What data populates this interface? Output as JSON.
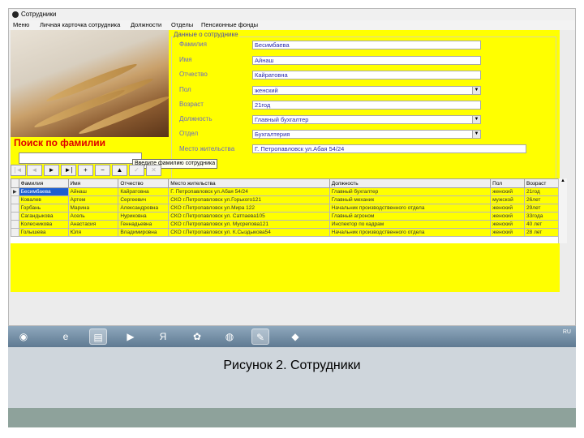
{
  "window": {
    "title": "Сотрудники"
  },
  "menu": [
    "Меню",
    "Личная карточка сотрудника",
    "Должности",
    "Отделы",
    "Пенсионные фонды"
  ],
  "details": {
    "group_title": "Данные о сотруднике",
    "fields": [
      {
        "label": "Фамилия",
        "value": "Бесимбаева",
        "type": "text"
      },
      {
        "label": "Имя",
        "value": "Айнаш",
        "type": "text"
      },
      {
        "label": "Отчество",
        "value": "Кайратовна",
        "type": "text"
      },
      {
        "label": "Пол",
        "value": "женский",
        "type": "combo"
      },
      {
        "label": "Возраст",
        "value": "21год",
        "type": "text"
      },
      {
        "label": "Должность",
        "value": "Главный бухгалтер",
        "type": "combo"
      },
      {
        "label": "Отдел",
        "value": "Бухгалтерия",
        "type": "combo"
      },
      {
        "label": "Место жительства",
        "value": "Г. Петропавловск ул.Абая 54/24",
        "type": "text"
      }
    ]
  },
  "search": {
    "title": "Поиск по фамилии",
    "input_value": "",
    "tooltip": "Введите фамилию сотрудника"
  },
  "navigator": {
    "buttons": [
      {
        "icon": "first-record-icon",
        "glyph": "|◄",
        "enabled": false
      },
      {
        "icon": "prior-record-icon",
        "glyph": "◄",
        "enabled": false
      },
      {
        "icon": "next-record-icon",
        "glyph": "►",
        "enabled": true
      },
      {
        "icon": "last-record-icon",
        "glyph": "►|",
        "enabled": true
      },
      {
        "icon": "insert-record-icon",
        "glyph": "+",
        "enabled": true
      },
      {
        "icon": "delete-record-icon",
        "glyph": "−",
        "enabled": true
      },
      {
        "icon": "edit-record-icon",
        "glyph": "▲",
        "enabled": true
      },
      {
        "icon": "post-record-icon",
        "glyph": "✓",
        "enabled": false
      },
      {
        "icon": "cancel-record-icon",
        "glyph": "✕",
        "enabled": false
      }
    ]
  },
  "grid": {
    "columns": [
      "Фамилия",
      "Имя",
      "Отчество",
      "Место жительства",
      "Должность",
      "Пол",
      "Возраст"
    ],
    "rows": [
      [
        "Бесимбаева",
        "Айнаш",
        "Кайратовна",
        "Г. Петропавловск ул.Абая 54/24",
        "Главный бухгалтер",
        "женский",
        "21год"
      ],
      [
        "Ковалев",
        "Артем",
        "Сергеевич",
        "СКО г.Петропавловск ул.Горького121",
        "Главный механик",
        "мужской",
        "26лет"
      ],
      [
        "Горбань",
        "Марина",
        "Александровна",
        "СКО г.Петропавловск ул.Мира 122",
        "Начальник производственного отдела",
        "женский",
        "29лет"
      ],
      [
        "Сагандыкова",
        "Асель",
        "Нуриковна",
        "СКО г.Петропавловск ул. Сатпаева105",
        "Главный агроном",
        "женский",
        "33года"
      ],
      [
        "Колесникова",
        "Анастасия",
        "Геннадьевна",
        "СКО г.Петропавловск ул. Мусрепова121",
        "Инспектор по кадрам",
        "женский",
        "40 лет"
      ],
      [
        "Голышева",
        "Юля",
        "Владимировна",
        "СКО г.Петропавловск ул. К.Сыздыкова54",
        "Начальник производственного отдела",
        "женский",
        "28 лет"
      ]
    ],
    "selected_row": 0
  },
  "taskbar": {
    "items": [
      {
        "icon": "start-windows-icon",
        "glyph": "◉"
      },
      {
        "icon": "internet-explorer-icon",
        "glyph": "e"
      },
      {
        "icon": "file-explorer-icon",
        "glyph": "▤"
      },
      {
        "icon": "media-player-icon",
        "glyph": "▶"
      },
      {
        "icon": "yandex-browser-icon",
        "glyph": "Я"
      },
      {
        "icon": "media-app-icon",
        "glyph": "✿"
      },
      {
        "icon": "chrome-icon",
        "glyph": "◍"
      },
      {
        "icon": "delphi-ide-icon",
        "glyph": "✎"
      },
      {
        "icon": "app-icon",
        "glyph": "◆"
      }
    ],
    "tray_text": "RU"
  },
  "caption": "Рисунок 2. Сотрудники"
}
